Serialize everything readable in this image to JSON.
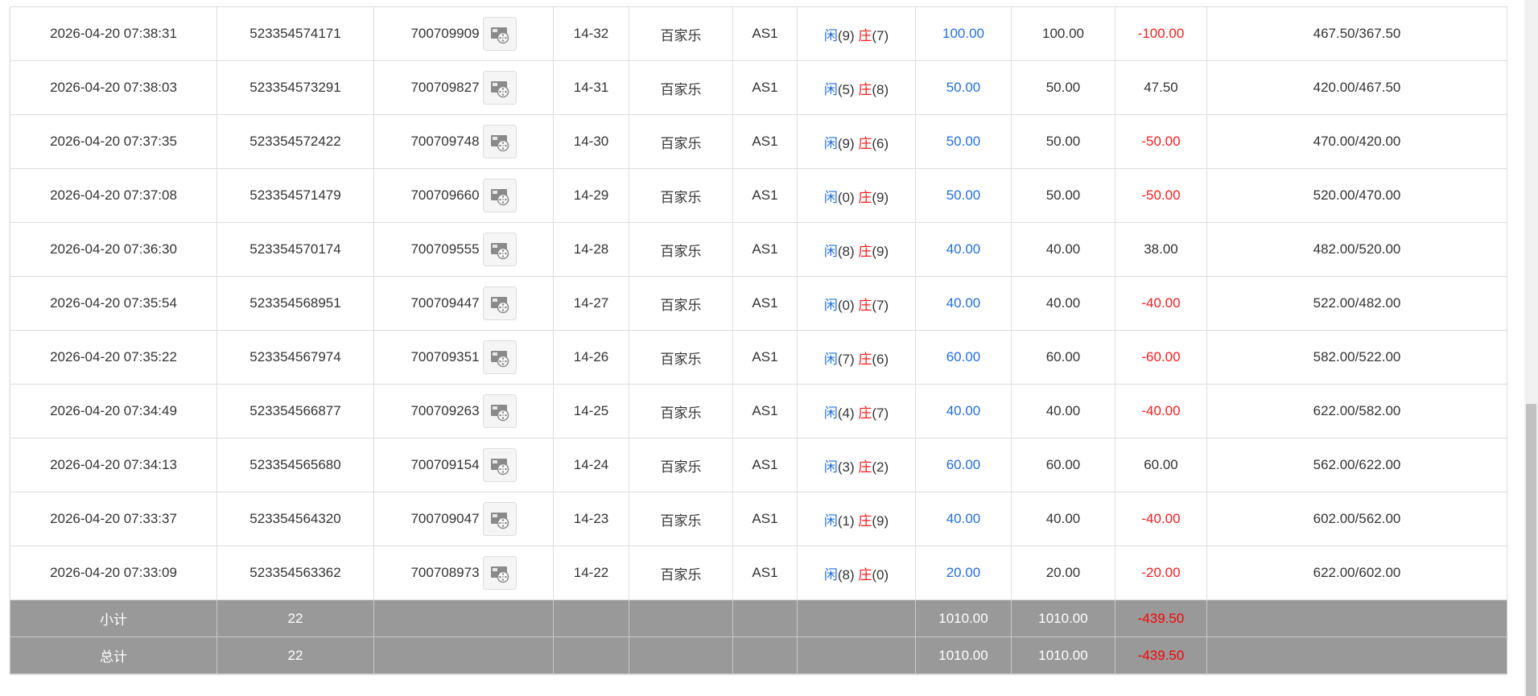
{
  "labels": {
    "player": "闲",
    "banker": "庄"
  },
  "icon": "video-replay-icon",
  "colors": {
    "blue": "#1f6fe8",
    "red": "#ff1a1a",
    "summary_bg": "#999999"
  },
  "rows": [
    {
      "time": "2026-04-20 07:38:31",
      "order_no": "523354574171",
      "game_no": "700709909",
      "round": "14-32",
      "game": "百家乐",
      "table": "AS1",
      "player_pts": "(9)",
      "banker_pts": "(7)",
      "bet": "100.00",
      "valid_bet": "100.00",
      "payout": "-100.00",
      "balance": "467.50/367.50"
    },
    {
      "time": "2026-04-20 07:38:03",
      "order_no": "523354573291",
      "game_no": "700709827",
      "round": "14-31",
      "game": "百家乐",
      "table": "AS1",
      "player_pts": "(5)",
      "banker_pts": "(8)",
      "bet": "50.00",
      "valid_bet": "50.00",
      "payout": "47.50",
      "balance": "420.00/467.50"
    },
    {
      "time": "2026-04-20 07:37:35",
      "order_no": "523354572422",
      "game_no": "700709748",
      "round": "14-30",
      "game": "百家乐",
      "table": "AS1",
      "player_pts": "(9)",
      "banker_pts": "(6)",
      "bet": "50.00",
      "valid_bet": "50.00",
      "payout": "-50.00",
      "balance": "470.00/420.00"
    },
    {
      "time": "2026-04-20 07:37:08",
      "order_no": "523354571479",
      "game_no": "700709660",
      "round": "14-29",
      "game": "百家乐",
      "table": "AS1",
      "player_pts": "(0)",
      "banker_pts": "(9)",
      "bet": "50.00",
      "valid_bet": "50.00",
      "payout": "-50.00",
      "balance": "520.00/470.00"
    },
    {
      "time": "2026-04-20 07:36:30",
      "order_no": "523354570174",
      "game_no": "700709555",
      "round": "14-28",
      "game": "百家乐",
      "table": "AS1",
      "player_pts": "(8)",
      "banker_pts": "(9)",
      "bet": "40.00",
      "valid_bet": "40.00",
      "payout": "38.00",
      "balance": "482.00/520.00"
    },
    {
      "time": "2026-04-20 07:35:54",
      "order_no": "523354568951",
      "game_no": "700709447",
      "round": "14-27",
      "game": "百家乐",
      "table": "AS1",
      "player_pts": "(0)",
      "banker_pts": "(7)",
      "bet": "40.00",
      "valid_bet": "40.00",
      "payout": "-40.00",
      "balance": "522.00/482.00"
    },
    {
      "time": "2026-04-20 07:35:22",
      "order_no": "523354567974",
      "game_no": "700709351",
      "round": "14-26",
      "game": "百家乐",
      "table": "AS1",
      "player_pts": "(7)",
      "banker_pts": "(6)",
      "bet": "60.00",
      "valid_bet": "60.00",
      "payout": "-60.00",
      "balance": "582.00/522.00"
    },
    {
      "time": "2026-04-20 07:34:49",
      "order_no": "523354566877",
      "game_no": "700709263",
      "round": "14-25",
      "game": "百家乐",
      "table": "AS1",
      "player_pts": "(4)",
      "banker_pts": "(7)",
      "bet": "40.00",
      "valid_bet": "40.00",
      "payout": "-40.00",
      "balance": "622.00/582.00"
    },
    {
      "time": "2026-04-20 07:34:13",
      "order_no": "523354565680",
      "game_no": "700709154",
      "round": "14-24",
      "game": "百家乐",
      "table": "AS1",
      "player_pts": "(3)",
      "banker_pts": "(2)",
      "bet": "60.00",
      "valid_bet": "60.00",
      "payout": "60.00",
      "balance": "562.00/622.00"
    },
    {
      "time": "2026-04-20 07:33:37",
      "order_no": "523354564320",
      "game_no": "700709047",
      "round": "14-23",
      "game": "百家乐",
      "table": "AS1",
      "player_pts": "(1)",
      "banker_pts": "(9)",
      "bet": "40.00",
      "valid_bet": "40.00",
      "payout": "-40.00",
      "balance": "602.00/562.00"
    },
    {
      "time": "2026-04-20 07:33:09",
      "order_no": "523354563362",
      "game_no": "700708973",
      "round": "14-22",
      "game": "百家乐",
      "table": "AS1",
      "player_pts": "(8)",
      "banker_pts": "(0)",
      "bet": "20.00",
      "valid_bet": "20.00",
      "payout": "-20.00",
      "balance": "622.00/602.00"
    }
  ],
  "summary": [
    {
      "label": "小计",
      "count": "22",
      "bet": "1010.00",
      "valid_bet": "1010.00",
      "payout": "-439.50"
    },
    {
      "label": "总计",
      "count": "22",
      "bet": "1010.00",
      "valid_bet": "1010.00",
      "payout": "-439.50"
    }
  ]
}
